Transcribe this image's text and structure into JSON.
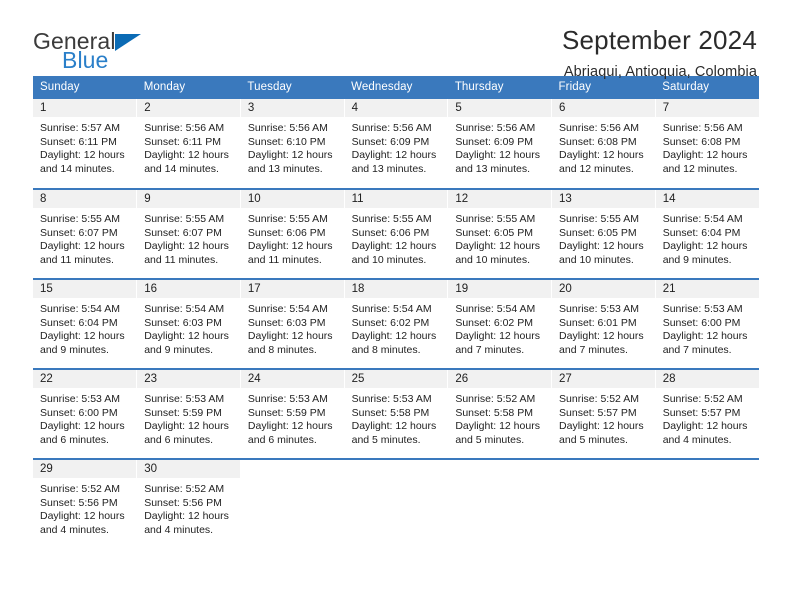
{
  "brand": {
    "name_part1": "General",
    "name_part2": "Blue",
    "flag_icon": "triangle-flag-icon",
    "accent_color": "#2a7fc9"
  },
  "header": {
    "title": "September 2024",
    "location": "Abriaqui, Antioquia, Colombia"
  },
  "theme": {
    "header_blue": "#3a79bd",
    "daynum_band": "#f1f1f1",
    "text": "#222222"
  },
  "weekday_headers": [
    "Sunday",
    "Monday",
    "Tuesday",
    "Wednesday",
    "Thursday",
    "Friday",
    "Saturday"
  ],
  "weeks": [
    [
      {
        "day": "1",
        "sunrise": "Sunrise: 5:57 AM",
        "sunset": "Sunset: 6:11 PM",
        "daylight_line1": "Daylight: 12 hours",
        "daylight_line2": "and 14 minutes."
      },
      {
        "day": "2",
        "sunrise": "Sunrise: 5:56 AM",
        "sunset": "Sunset: 6:11 PM",
        "daylight_line1": "Daylight: 12 hours",
        "daylight_line2": "and 14 minutes."
      },
      {
        "day": "3",
        "sunrise": "Sunrise: 5:56 AM",
        "sunset": "Sunset: 6:10 PM",
        "daylight_line1": "Daylight: 12 hours",
        "daylight_line2": "and 13 minutes."
      },
      {
        "day": "4",
        "sunrise": "Sunrise: 5:56 AM",
        "sunset": "Sunset: 6:09 PM",
        "daylight_line1": "Daylight: 12 hours",
        "daylight_line2": "and 13 minutes."
      },
      {
        "day": "5",
        "sunrise": "Sunrise: 5:56 AM",
        "sunset": "Sunset: 6:09 PM",
        "daylight_line1": "Daylight: 12 hours",
        "daylight_line2": "and 13 minutes."
      },
      {
        "day": "6",
        "sunrise": "Sunrise: 5:56 AM",
        "sunset": "Sunset: 6:08 PM",
        "daylight_line1": "Daylight: 12 hours",
        "daylight_line2": "and 12 minutes."
      },
      {
        "day": "7",
        "sunrise": "Sunrise: 5:56 AM",
        "sunset": "Sunset: 6:08 PM",
        "daylight_line1": "Daylight: 12 hours",
        "daylight_line2": "and 12 minutes."
      }
    ],
    [
      {
        "day": "8",
        "sunrise": "Sunrise: 5:55 AM",
        "sunset": "Sunset: 6:07 PM",
        "daylight_line1": "Daylight: 12 hours",
        "daylight_line2": "and 11 minutes."
      },
      {
        "day": "9",
        "sunrise": "Sunrise: 5:55 AM",
        "sunset": "Sunset: 6:07 PM",
        "daylight_line1": "Daylight: 12 hours",
        "daylight_line2": "and 11 minutes."
      },
      {
        "day": "10",
        "sunrise": "Sunrise: 5:55 AM",
        "sunset": "Sunset: 6:06 PM",
        "daylight_line1": "Daylight: 12 hours",
        "daylight_line2": "and 11 minutes."
      },
      {
        "day": "11",
        "sunrise": "Sunrise: 5:55 AM",
        "sunset": "Sunset: 6:06 PM",
        "daylight_line1": "Daylight: 12 hours",
        "daylight_line2": "and 10 minutes."
      },
      {
        "day": "12",
        "sunrise": "Sunrise: 5:55 AM",
        "sunset": "Sunset: 6:05 PM",
        "daylight_line1": "Daylight: 12 hours",
        "daylight_line2": "and 10 minutes."
      },
      {
        "day": "13",
        "sunrise": "Sunrise: 5:55 AM",
        "sunset": "Sunset: 6:05 PM",
        "daylight_line1": "Daylight: 12 hours",
        "daylight_line2": "and 10 minutes."
      },
      {
        "day": "14",
        "sunrise": "Sunrise: 5:54 AM",
        "sunset": "Sunset: 6:04 PM",
        "daylight_line1": "Daylight: 12 hours",
        "daylight_line2": "and 9 minutes."
      }
    ],
    [
      {
        "day": "15",
        "sunrise": "Sunrise: 5:54 AM",
        "sunset": "Sunset: 6:04 PM",
        "daylight_line1": "Daylight: 12 hours",
        "daylight_line2": "and 9 minutes."
      },
      {
        "day": "16",
        "sunrise": "Sunrise: 5:54 AM",
        "sunset": "Sunset: 6:03 PM",
        "daylight_line1": "Daylight: 12 hours",
        "daylight_line2": "and 9 minutes."
      },
      {
        "day": "17",
        "sunrise": "Sunrise: 5:54 AM",
        "sunset": "Sunset: 6:03 PM",
        "daylight_line1": "Daylight: 12 hours",
        "daylight_line2": "and 8 minutes."
      },
      {
        "day": "18",
        "sunrise": "Sunrise: 5:54 AM",
        "sunset": "Sunset: 6:02 PM",
        "daylight_line1": "Daylight: 12 hours",
        "daylight_line2": "and 8 minutes."
      },
      {
        "day": "19",
        "sunrise": "Sunrise: 5:54 AM",
        "sunset": "Sunset: 6:02 PM",
        "daylight_line1": "Daylight: 12 hours",
        "daylight_line2": "and 7 minutes."
      },
      {
        "day": "20",
        "sunrise": "Sunrise: 5:53 AM",
        "sunset": "Sunset: 6:01 PM",
        "daylight_line1": "Daylight: 12 hours",
        "daylight_line2": "and 7 minutes."
      },
      {
        "day": "21",
        "sunrise": "Sunrise: 5:53 AM",
        "sunset": "Sunset: 6:00 PM",
        "daylight_line1": "Daylight: 12 hours",
        "daylight_line2": "and 7 minutes."
      }
    ],
    [
      {
        "day": "22",
        "sunrise": "Sunrise: 5:53 AM",
        "sunset": "Sunset: 6:00 PM",
        "daylight_line1": "Daylight: 12 hours",
        "daylight_line2": "and 6 minutes."
      },
      {
        "day": "23",
        "sunrise": "Sunrise: 5:53 AM",
        "sunset": "Sunset: 5:59 PM",
        "daylight_line1": "Daylight: 12 hours",
        "daylight_line2": "and 6 minutes."
      },
      {
        "day": "24",
        "sunrise": "Sunrise: 5:53 AM",
        "sunset": "Sunset: 5:59 PM",
        "daylight_line1": "Daylight: 12 hours",
        "daylight_line2": "and 6 minutes."
      },
      {
        "day": "25",
        "sunrise": "Sunrise: 5:53 AM",
        "sunset": "Sunset: 5:58 PM",
        "daylight_line1": "Daylight: 12 hours",
        "daylight_line2": "and 5 minutes."
      },
      {
        "day": "26",
        "sunrise": "Sunrise: 5:52 AM",
        "sunset": "Sunset: 5:58 PM",
        "daylight_line1": "Daylight: 12 hours",
        "daylight_line2": "and 5 minutes."
      },
      {
        "day": "27",
        "sunrise": "Sunrise: 5:52 AM",
        "sunset": "Sunset: 5:57 PM",
        "daylight_line1": "Daylight: 12 hours",
        "daylight_line2": "and 5 minutes."
      },
      {
        "day": "28",
        "sunrise": "Sunrise: 5:52 AM",
        "sunset": "Sunset: 5:57 PM",
        "daylight_line1": "Daylight: 12 hours",
        "daylight_line2": "and 4 minutes."
      }
    ],
    [
      {
        "day": "29",
        "sunrise": "Sunrise: 5:52 AM",
        "sunset": "Sunset: 5:56 PM",
        "daylight_line1": "Daylight: 12 hours",
        "daylight_line2": "and 4 minutes."
      },
      {
        "day": "30",
        "sunrise": "Sunrise: 5:52 AM",
        "sunset": "Sunset: 5:56 PM",
        "daylight_line1": "Daylight: 12 hours",
        "daylight_line2": "and 4 minutes."
      },
      {
        "day": "",
        "sunrise": "",
        "sunset": "",
        "daylight_line1": "",
        "daylight_line2": ""
      },
      {
        "day": "",
        "sunrise": "",
        "sunset": "",
        "daylight_line1": "",
        "daylight_line2": ""
      },
      {
        "day": "",
        "sunrise": "",
        "sunset": "",
        "daylight_line1": "",
        "daylight_line2": ""
      },
      {
        "day": "",
        "sunrise": "",
        "sunset": "",
        "daylight_line1": "",
        "daylight_line2": ""
      },
      {
        "day": "",
        "sunrise": "",
        "sunset": "",
        "daylight_line1": "",
        "daylight_line2": ""
      }
    ]
  ]
}
